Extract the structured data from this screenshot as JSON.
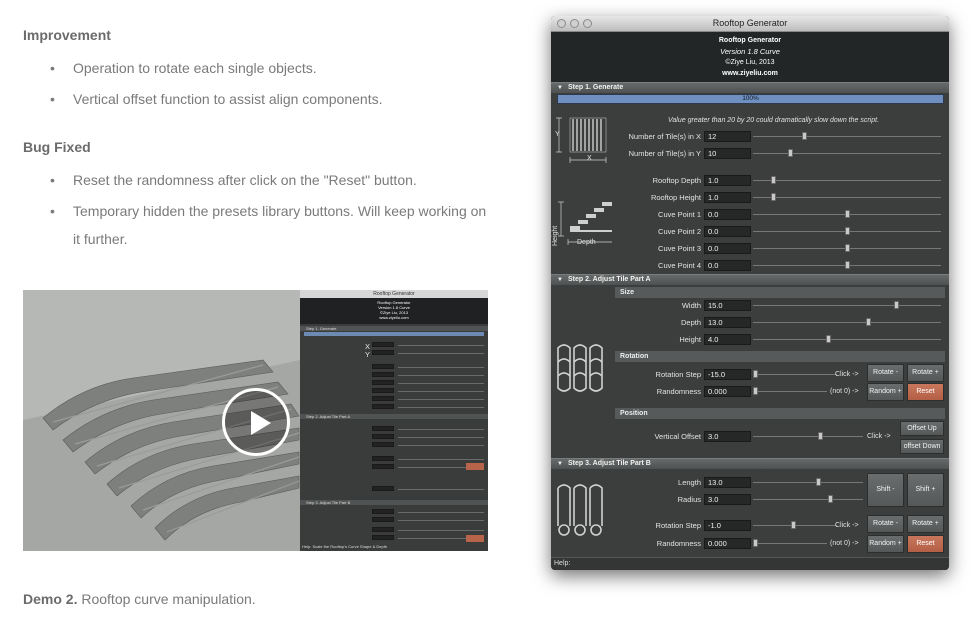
{
  "article": {
    "improvement_heading": "Improvement",
    "improvement_items": [
      "Operation to rotate each single objects.",
      "Vertical offset function to assist align components."
    ],
    "bugfix_heading": "Bug Fixed",
    "bugfix_items": [
      "Reset the randomness after click on the \"Reset\" button.",
      "Temporary hidden the presets library buttons. Will keep working on it further."
    ],
    "caption_bold": "Demo 2.",
    "caption_text": " Rooftop curve manipulation."
  },
  "video": {
    "play_icon": "play-icon",
    "mini_title": "Rooftop Generator",
    "mini_help": "Help:   Scale the Rooftop's Curve Shape & Depth"
  },
  "window": {
    "title": "Rooftop Generator",
    "header": {
      "name": "Rooftop Generator",
      "version": "Version 1.8 Curve",
      "copyright": "©Ziye Liu, 2013",
      "url": "www.ziyeliu.com"
    },
    "step1": {
      "title": "Step 1. Generate",
      "progress": "100%",
      "progress_fraction": 1.0,
      "warning": "Value greater than 20 by 20 could dramatically slow down the script.",
      "diagram_x": "X",
      "diagram_y": "Y",
      "diagram_height": "Height",
      "diagram_depth": "Depth",
      "fields": [
        {
          "label": "Number of Tile(s) in X",
          "value": "12",
          "slider": 0.27
        },
        {
          "label": "Number of Tile(s) in Y",
          "value": "10",
          "slider": 0.19
        },
        {
          "label": "Rooftop Depth",
          "value": "1.0",
          "slider": 0.1
        },
        {
          "label": "Rooftop Height",
          "value": "1.0",
          "slider": 0.1
        },
        {
          "label": "Cuve Point 1",
          "value": "0.0",
          "slider": 0.5
        },
        {
          "label": "Cuve Point 2",
          "value": "0.0",
          "slider": 0.5
        },
        {
          "label": "Cuve Point 3",
          "value": "0.0",
          "slider": 0.5
        },
        {
          "label": "Cuve Point 4",
          "value": "0.0",
          "slider": 0.5
        }
      ]
    },
    "step2": {
      "title": "Step 2. Adjust Tile Part A",
      "size_title": "Size",
      "size_fields": [
        {
          "label": "Width",
          "value": "15.0",
          "slider": 0.77
        },
        {
          "label": "Depth",
          "value": "13.0",
          "slider": 0.62
        },
        {
          "label": "Height",
          "value": "4.0",
          "slider": 0.4
        }
      ],
      "rotation_title": "Rotation",
      "rotation_step_label": "Rotation Step",
      "rotation_step_value": "-15.0",
      "rotation_step_slider": 0.0,
      "click_note": "Click ->",
      "rotate_minus": "Rotate -",
      "rotate_plus": "Rotate +",
      "randomness_label": "Randomness",
      "randomness_value": "0.000",
      "randomness_slider": 0.0,
      "not0_note": "(not 0) ->",
      "random_plus": "Random +",
      "reset": "Reset",
      "position_title": "Position",
      "vertical_offset_label": "Vertical Offset",
      "vertical_offset_value": "3.0",
      "vertical_offset_slider": 0.62,
      "click_note2": "Click ->",
      "offset_up": "Offset Up",
      "offset_down": "offset Down"
    },
    "step3": {
      "title": "Step 3. Adjust Tile Part B",
      "length_label": "Length",
      "length_value": "13.0",
      "length_slider": 0.6,
      "radius_label": "Radius",
      "radius_value": "3.0",
      "radius_slider": 0.71,
      "shift_minus": "Shift -",
      "shift_plus": "Shift +",
      "rotation_step_label": "Rotation Step",
      "rotation_step_value": "-1.0",
      "rotation_step_slider": 0.48,
      "click_note": "Click ->",
      "rotate_minus": "Rotate -",
      "rotate_plus": "Rotate +",
      "randomness_label": "Randomness",
      "randomness_value": "0.000",
      "randomness_slider": 0.0,
      "not0_note": "(not 0) ->",
      "random_plus": "Random +",
      "reset": "Reset"
    },
    "help_label": "Help:"
  },
  "colors": {
    "accent_reset": "#b8644a",
    "progress": "#6e8fc0",
    "window_bg": "#3c3e3e"
  }
}
